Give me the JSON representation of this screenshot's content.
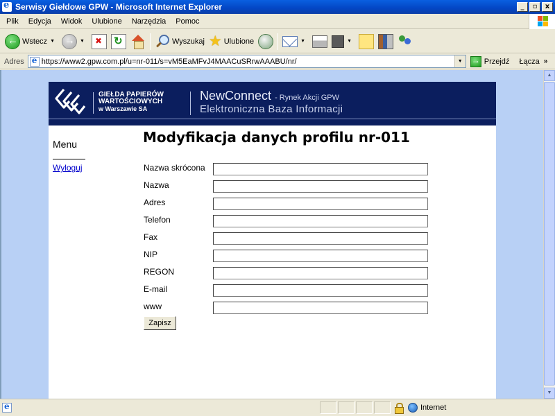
{
  "window": {
    "title": "Serwisy Giełdowe GPW - Microsoft Internet Explorer",
    "controls": [
      "_",
      "▫",
      "x"
    ]
  },
  "menu": [
    "Plik",
    "Edycja",
    "Widok",
    "Ulubione",
    "Narzędzia",
    "Pomoc"
  ],
  "toolbar": {
    "back_label": "Wstecz",
    "search_label": "Wyszukaj",
    "favorites_label": "Ulubione"
  },
  "addressbar": {
    "label": "Adres",
    "url": "https://www2.gpw.com.pl/u=nr-011/s=vM5EaMFvJ4MAACuSRrwAAABU/nr/",
    "go_label": "Przejdź",
    "links_label": "Łącza"
  },
  "header": {
    "logo_line1": "GIEŁDA PAPIERÓW",
    "logo_line2": "WARTOŚCIOWYCH",
    "logo_line3": "w Warszawie SA",
    "brand": "NewConnect",
    "brand_sub": "- Rynek Akcji GPW",
    "tagline": "Elektroniczna Baza Informacji"
  },
  "sidebar": {
    "title": "Menu",
    "logout": "Wyloguj"
  },
  "main": {
    "title": "Modyfikacja danych profilu nr-011",
    "fields": [
      {
        "label": "Nazwa skrócona",
        "value": ""
      },
      {
        "label": "Nazwa",
        "value": ""
      },
      {
        "label": "Adres",
        "value": ""
      },
      {
        "label": "Telefon",
        "value": ""
      },
      {
        "label": "Fax",
        "value": ""
      },
      {
        "label": "NIP",
        "value": ""
      },
      {
        "label": "REGON",
        "value": ""
      },
      {
        "label": "E-mail",
        "value": ""
      },
      {
        "label": "www",
        "value": ""
      }
    ],
    "save_label": "Zapisz"
  },
  "statusbar": {
    "status_text": "",
    "zone": "Internet"
  },
  "colors": {
    "header_bg": "#0b1e5e",
    "viewport_bg": "#b8d0f5",
    "link": "#0000cc"
  }
}
